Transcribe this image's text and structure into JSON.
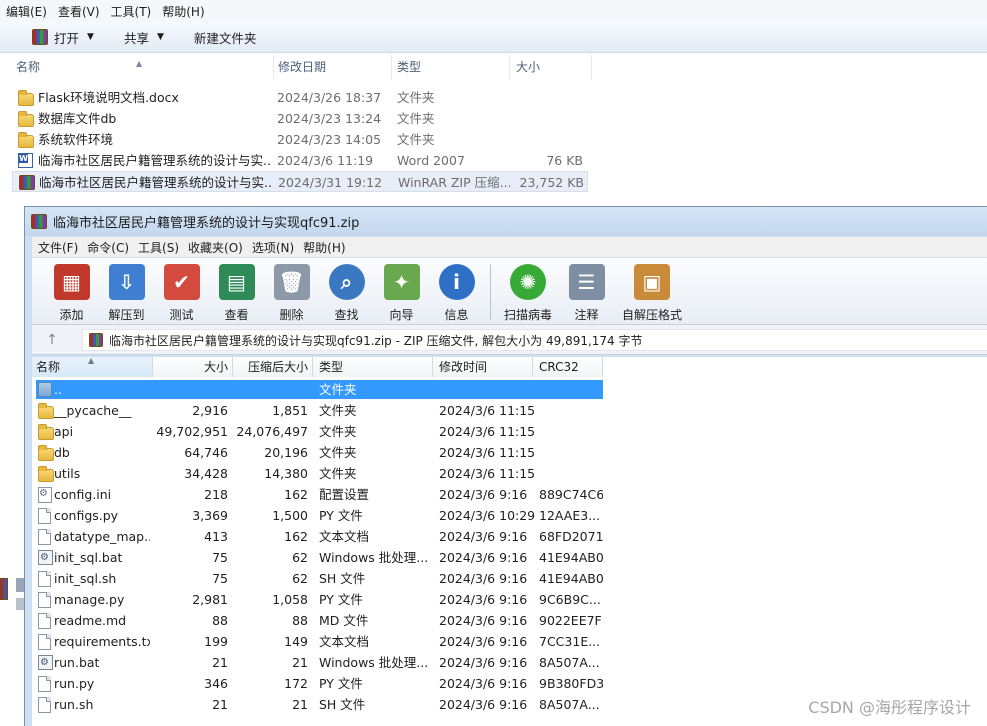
{
  "explorer": {
    "menu": [
      "编辑(E)",
      "查看(V)",
      "工具(T)",
      "帮助(H)"
    ],
    "toolbar": {
      "open": "打开",
      "share": "共享",
      "new_folder": "新建文件夹"
    },
    "columns": {
      "name": "名称",
      "date": "修改日期",
      "type": "类型",
      "size": "大小"
    },
    "files": [
      {
        "name": "Flask环境说明文档.docx",
        "date": "2024/3/26 18:37",
        "type": "文件夹",
        "size": "",
        "icon": "folder-icon"
      },
      {
        "name": "数据库文件db",
        "date": "2024/3/23 13:24",
        "type": "文件夹",
        "size": "",
        "icon": "folder-icon"
      },
      {
        "name": "系统软件环境",
        "date": "2024/3/23 14:05",
        "type": "文件夹",
        "size": "",
        "icon": "folder-icon"
      },
      {
        "name": "临海市社区居民户籍管理系统的设计与实...",
        "date": "2024/3/6 11:19",
        "type": "Word 2007",
        "size": "76 KB",
        "icon": "word-doc-icon"
      },
      {
        "name": "临海市社区居民户籍管理系统的设计与实...",
        "date": "2024/3/31 19:12",
        "type": "WinRAR ZIP 压缩...",
        "size": "23,752 KB",
        "icon": "rar-archive-icon",
        "selected": true
      }
    ]
  },
  "winrar": {
    "title": "临海市社区居民户籍管理系统的设计与实现qfc91.zip",
    "menu": [
      "文件(F)",
      "命令(C)",
      "工具(S)",
      "收藏夹(O)",
      "选项(N)",
      "帮助(H)"
    ],
    "toolbar": [
      {
        "label": "添加",
        "icon": "add-icon",
        "color": "#c0392b"
      },
      {
        "label": "解压到",
        "icon": "extract-to-icon",
        "color": "#3f7fd1"
      },
      {
        "label": "测试",
        "icon": "test-icon",
        "color": "#d24b3e"
      },
      {
        "label": "查看",
        "icon": "view-icon",
        "color": "#2e8b57"
      },
      {
        "label": "删除",
        "icon": "delete-icon",
        "color": "#8d99a8"
      },
      {
        "label": "查找",
        "icon": "find-icon",
        "color": "#3b78c2"
      },
      {
        "label": "向导",
        "icon": "wizard-icon",
        "color": "#6aa84f"
      },
      {
        "label": "信息",
        "icon": "info-icon",
        "color": "#2f6fc5"
      },
      {
        "label": "扫描病毒",
        "icon": "virus-scan-icon",
        "color": "#36a936"
      },
      {
        "label": "注释",
        "icon": "comment-icon",
        "color": "#7f8fa3"
      },
      {
        "label": "自解压格式",
        "icon": "sfx-icon",
        "color": "#c98a3a"
      }
    ],
    "path": "临海市社区居民户籍管理系统的设计与实现qfc91.zip - ZIP 压缩文件, 解包大小为 49,891,174 字节",
    "columns": {
      "name": "名称",
      "size": "大小",
      "packed": "压缩后大小",
      "type": "类型",
      "modified": "修改时间",
      "crc": "CRC32"
    },
    "files": [
      {
        "name": "..",
        "size": "",
        "packed": "",
        "type": "文件夹",
        "modified": "",
        "crc": "",
        "icon": "parent-folder-icon",
        "selected": true
      },
      {
        "name": "__pycache__",
        "size": "2,916",
        "packed": "1,851",
        "type": "文件夹",
        "modified": "2024/3/6 11:15",
        "crc": "",
        "icon": "folder-icon"
      },
      {
        "name": "api",
        "size": "49,702,951",
        "packed": "24,076,497",
        "type": "文件夹",
        "modified": "2024/3/6 11:15",
        "crc": "",
        "icon": "folder-icon"
      },
      {
        "name": "db",
        "size": "64,746",
        "packed": "20,196",
        "type": "文件夹",
        "modified": "2024/3/6 11:15",
        "crc": "",
        "icon": "folder-icon"
      },
      {
        "name": "utils",
        "size": "34,428",
        "packed": "14,380",
        "type": "文件夹",
        "modified": "2024/3/6 11:15",
        "crc": "",
        "icon": "folder-icon"
      },
      {
        "name": "config.ini",
        "size": "218",
        "packed": "162",
        "type": "配置设置",
        "modified": "2024/3/6 9:16",
        "crc": "889C74C6",
        "icon": "config-file-icon"
      },
      {
        "name": "configs.py",
        "size": "3,369",
        "packed": "1,500",
        "type": "PY 文件",
        "modified": "2024/3/6 10:29",
        "crc": "12AAE3...",
        "icon": "file-icon"
      },
      {
        "name": "datatype_map....",
        "size": "413",
        "packed": "162",
        "type": "文本文档",
        "modified": "2024/3/6 9:16",
        "crc": "68FD2071",
        "icon": "file-icon"
      },
      {
        "name": "init_sql.bat",
        "size": "75",
        "packed": "62",
        "type": "Windows 批处理...",
        "modified": "2024/3/6 9:16",
        "crc": "41E94AB0",
        "icon": "batch-file-icon"
      },
      {
        "name": "init_sql.sh",
        "size": "75",
        "packed": "62",
        "type": "SH 文件",
        "modified": "2024/3/6 9:16",
        "crc": "41E94AB0",
        "icon": "file-icon"
      },
      {
        "name": "manage.py",
        "size": "2,981",
        "packed": "1,058",
        "type": "PY 文件",
        "modified": "2024/3/6 9:16",
        "crc": "9C6B9C...",
        "icon": "file-icon"
      },
      {
        "name": "readme.md",
        "size": "88",
        "packed": "88",
        "type": "MD 文件",
        "modified": "2024/3/6 9:16",
        "crc": "9022EE7F",
        "icon": "file-icon"
      },
      {
        "name": "requirements.txt",
        "size": "199",
        "packed": "149",
        "type": "文本文档",
        "modified": "2024/3/6 9:16",
        "crc": "7CC31E...",
        "icon": "file-icon"
      },
      {
        "name": "run.bat",
        "size": "21",
        "packed": "21",
        "type": "Windows 批处理...",
        "modified": "2024/3/6 9:16",
        "crc": "8A507A...",
        "icon": "batch-file-icon"
      },
      {
        "name": "run.py",
        "size": "346",
        "packed": "172",
        "type": "PY 文件",
        "modified": "2024/3/6 9:16",
        "crc": "9B380FD3",
        "icon": "file-icon"
      },
      {
        "name": "run.sh",
        "size": "21",
        "packed": "21",
        "type": "SH 文件",
        "modified": "2024/3/6 9:16",
        "crc": "8A507A...",
        "icon": "file-icon"
      }
    ]
  },
  "watermark": "CSDN @海彤程序设计"
}
